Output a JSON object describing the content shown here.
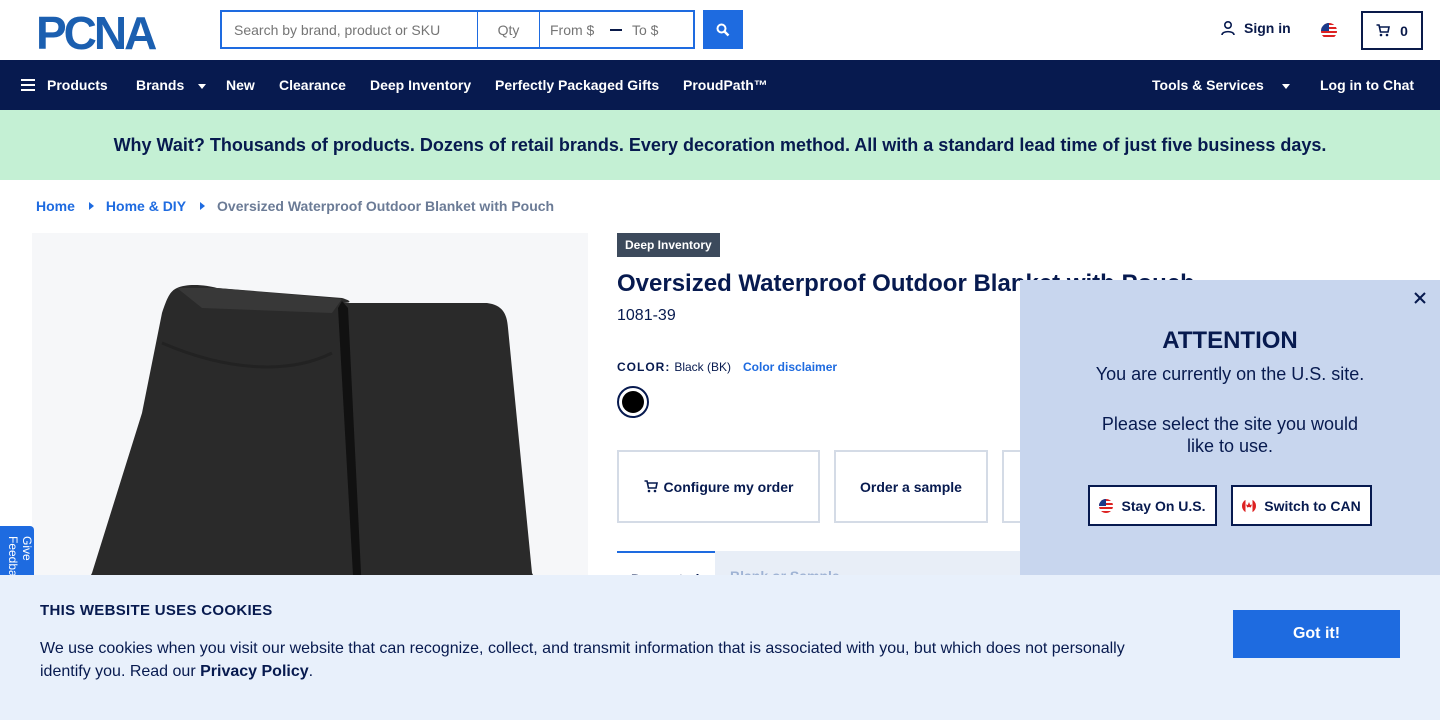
{
  "header": {
    "logo_text": "PCNA",
    "search_placeholder": "Search by brand, product or SKU",
    "qty_placeholder": "Qty",
    "price_from_placeholder": "From $",
    "price_to_placeholder": "To $",
    "signin_label": "Sign in",
    "cart_count": "0"
  },
  "nav": {
    "products": "Products",
    "brands": "Brands",
    "new": "New",
    "clearance": "Clearance",
    "deep_inventory": "Deep Inventory",
    "gifts": "Perfectly Packaged Gifts",
    "proudpath": "ProudPath™",
    "tools": "Tools & Services",
    "chat": "Log in to Chat"
  },
  "promo": {
    "text": "Why Wait? Thousands of products. Dozens of retail brands. Every decoration method. All with a standard lead time of just five business days."
  },
  "breadcrumb": {
    "home": "Home",
    "category": "Home & DIY",
    "current": "Oversized Waterproof Outdoor Blanket with Pouch"
  },
  "product": {
    "badge": "Deep Inventory",
    "title": "Oversized Waterproof Outdoor Blanket with Pouch",
    "sku": "1081-39",
    "color_label": "COLOR:",
    "color_value": "Black (BK)",
    "color_disclaimer": "Color disclaimer",
    "configure_label": "Configure my order",
    "sample_label": "Order a sample",
    "tab_active": "Decorated",
    "tab_other": "Blank or Sample"
  },
  "feedback": {
    "label": "Give Feedback"
  },
  "attention": {
    "title": "ATTENTION",
    "message1": "You are currently on the U.S. site.",
    "message2": "Please select the site you would like to use.",
    "stay_label": "Stay On U.S.",
    "switch_label": "Switch to CAN"
  },
  "cookie": {
    "title": "THIS WEBSITE USES COOKIES",
    "text": "We use cookies when you visit our website that can recognize, collect, and transmit information that is associated with you, but which does not personally identify you. Read our",
    "privacy_link": "Privacy Policy",
    "period": ".",
    "button": "Got it!"
  },
  "colors": {
    "navy": "#071a4f",
    "blue": "#1e6be0",
    "promo_bg": "#c4f0d4",
    "modal_bg": "#c8d6ee",
    "cookie_bg": "#e8f0fb"
  }
}
